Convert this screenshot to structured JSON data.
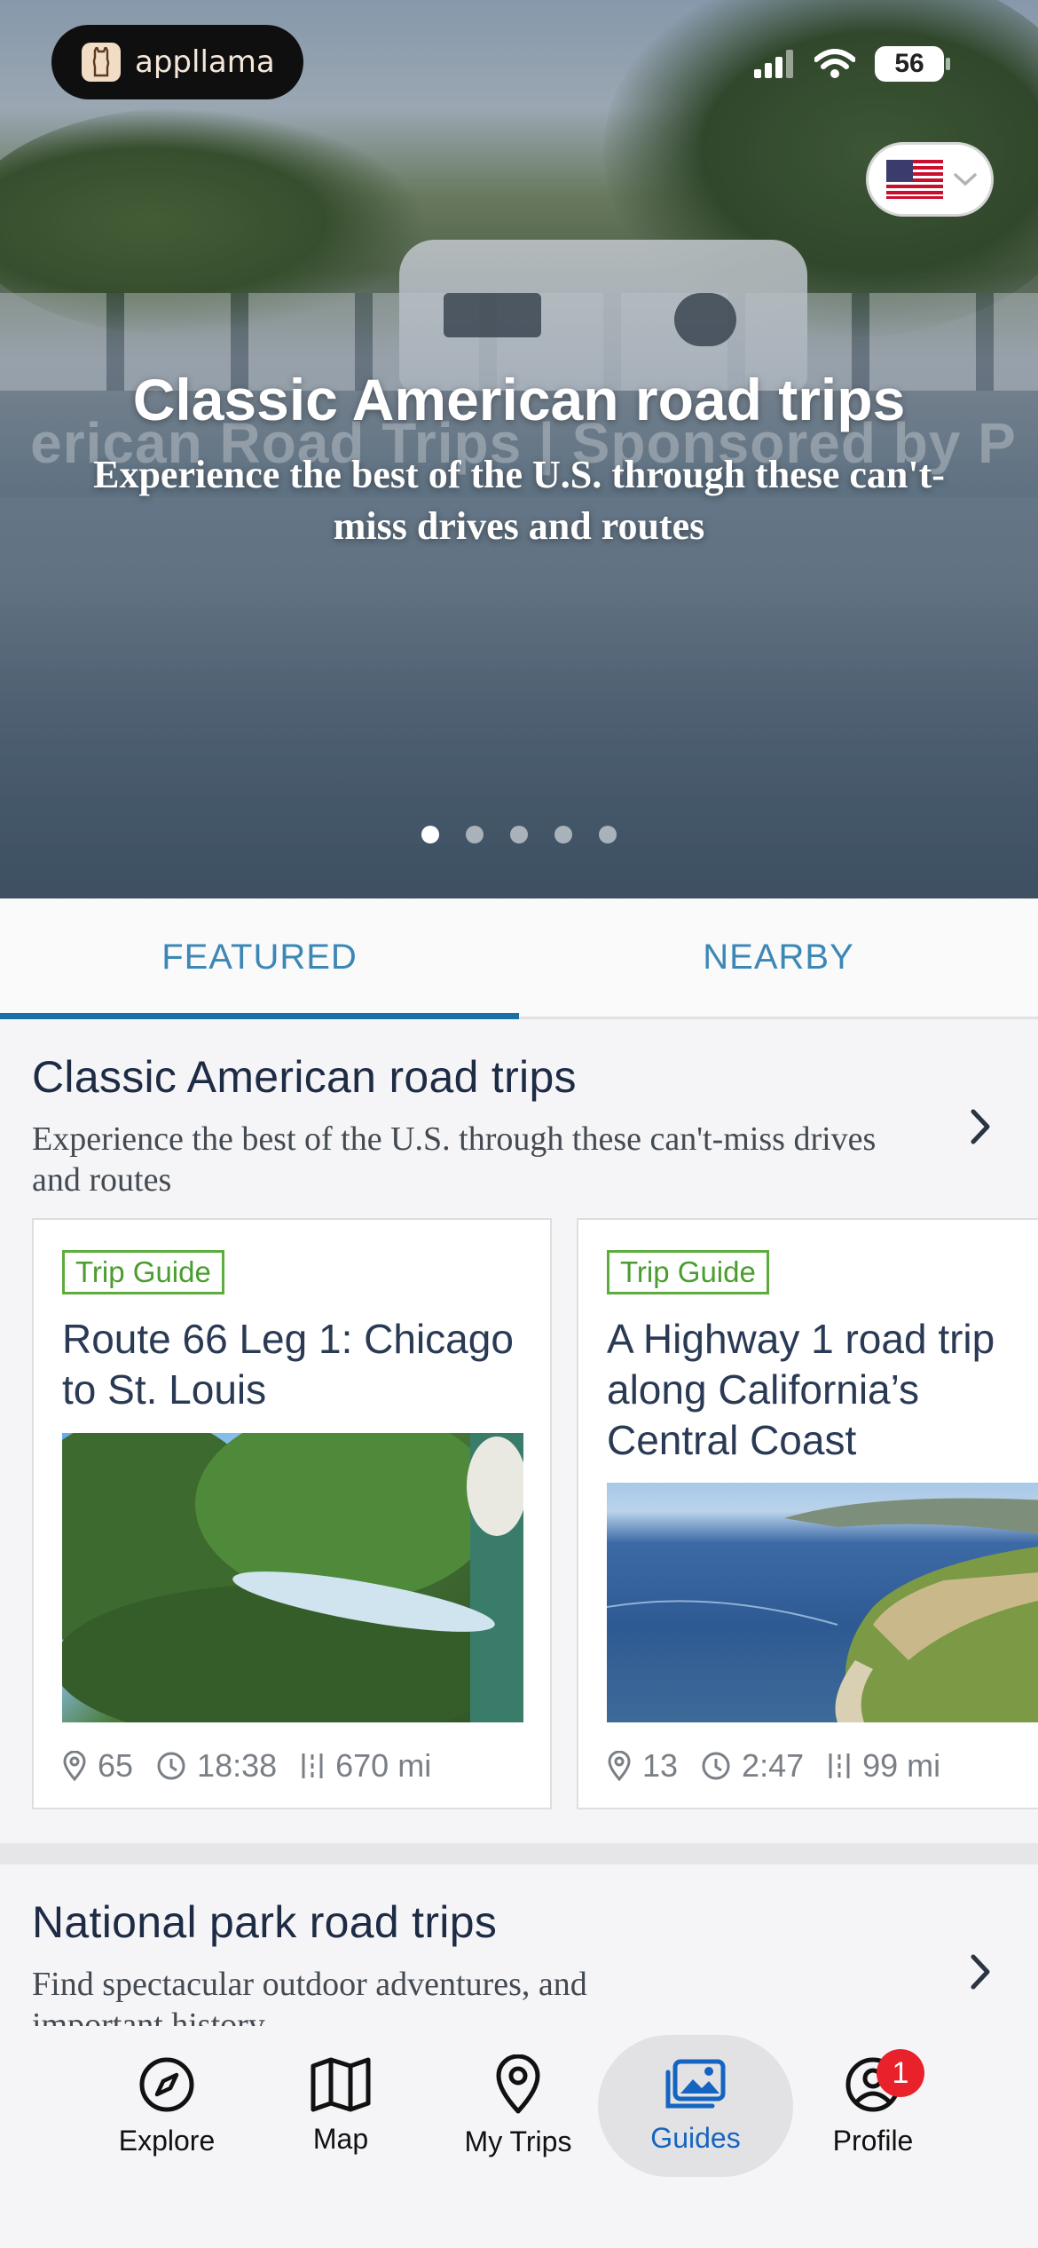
{
  "status_bar": {
    "app_name": "appllama",
    "battery": "56"
  },
  "hero": {
    "title": "Classic American road trips",
    "subtitle": "Experience the best of the U.S. through these can't-miss drives and routes",
    "watermark": "erican Road Trips | Sponsored by P",
    "carousel": {
      "count": 5,
      "active_index": 0
    },
    "country": "US"
  },
  "tabs": [
    {
      "label": "FEATURED",
      "active": true
    },
    {
      "label": "NEARBY",
      "active": false
    }
  ],
  "sections": [
    {
      "title": "Classic American road trips",
      "description": "Experience the best of the U.S. through these can't-miss drives and routes",
      "cards": [
        {
          "badge": "Trip Guide",
          "title": "Route 66 Leg 1: Chicago to St. Louis",
          "stops": "65",
          "duration": "18:38",
          "distance": "670 mi"
        },
        {
          "badge": "Trip Guide",
          "title": "A Highway 1 road trip along California’s Central Coast",
          "stops": "13",
          "duration": "2:47",
          "distance": "99 mi"
        }
      ]
    },
    {
      "title": "National park road trips",
      "description": "Find spectacular outdoor adventures, and important history"
    }
  ],
  "bottom_nav": [
    {
      "label": "Explore",
      "icon": "compass-icon",
      "active": false
    },
    {
      "label": "Map",
      "icon": "map-icon",
      "active": false
    },
    {
      "label": "My Trips",
      "icon": "location-pin-icon",
      "active": false
    },
    {
      "label": "Guides",
      "icon": "photos-icon",
      "active": true
    },
    {
      "label": "Profile",
      "icon": "user-circle-icon",
      "active": false,
      "badge": "1"
    }
  ],
  "colors": {
    "accent": "#1a6fa4",
    "tab_text": "#3c87b6",
    "badge_green": "#4a9d2f",
    "active_nav": "#1565c0",
    "notification": "#e8212a"
  }
}
